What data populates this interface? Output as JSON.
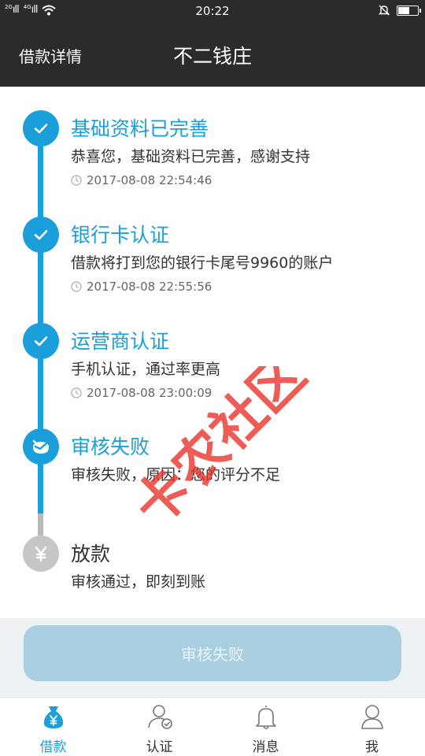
{
  "status_bar": {
    "signal_1_label": "2G",
    "signal_2_label": "4G",
    "time": "20:22",
    "battery_level": 0.6
  },
  "nav": {
    "back_label": "借款详情",
    "title": "不二钱庄"
  },
  "steps": [
    {
      "title": "基础资料已完善",
      "desc": "恭喜您，基础资料已完善，感谢支持",
      "time": "2017-08-08 22:54:46",
      "status": "done"
    },
    {
      "title": "银行卡认证",
      "desc": "借款将打到您的银行卡尾号9960的账户",
      "time": "2017-08-08 22:55:56",
      "status": "done"
    },
    {
      "title": "运营商认证",
      "desc": "手机认证，通过率更高",
      "time": "2017-08-08 23:00:09",
      "status": "done"
    },
    {
      "title": "审核失败",
      "desc": "审核失败，原因：您的评分不足",
      "status": "failed"
    },
    {
      "title": "放款",
      "desc": "审核通过，即刻到账",
      "status": "pending"
    }
  ],
  "watermark_text": "卡农社区",
  "action_button": {
    "label": "审核失败"
  },
  "tabs": [
    {
      "label": "借款",
      "icon": "money-bag-icon",
      "active": true
    },
    {
      "label": "认证",
      "icon": "user-verified-icon",
      "active": false
    },
    {
      "label": "消息",
      "icon": "bell-icon",
      "active": false
    },
    {
      "label": "我",
      "icon": "person-icon",
      "active": false
    }
  ],
  "colors": {
    "accent": "#1a9fdb",
    "header_bg": "#2b2b2d",
    "button_disabled": "#a9cfe0",
    "watermark": "#e8332a"
  }
}
